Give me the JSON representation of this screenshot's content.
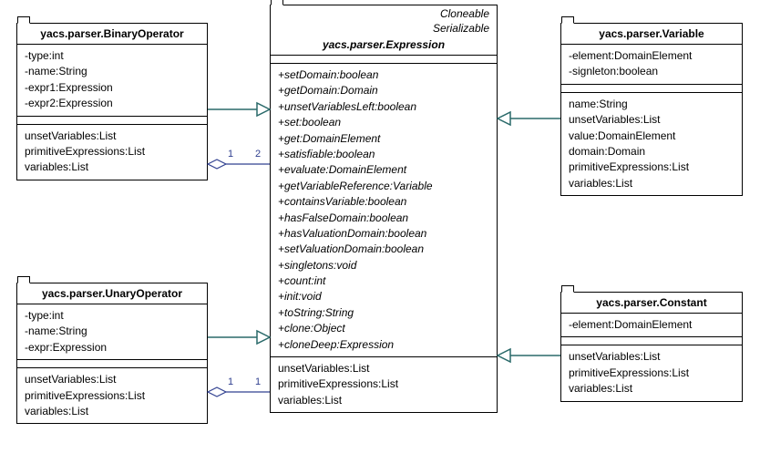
{
  "classes": {
    "binaryOperator": {
      "title": "yacs.parser.BinaryOperator",
      "attrs": [
        "-type:int",
        "-name:String",
        "-expr1:Expression",
        "-expr2:Expression"
      ],
      "members": [
        "unsetVariables:List",
        "primitiveExpressions:List",
        "variables:List"
      ]
    },
    "unaryOperator": {
      "title": "yacs.parser.UnaryOperator",
      "attrs": [
        "-type:int",
        "-name:String",
        "-expr:Expression"
      ],
      "members": [
        "unsetVariables:List",
        "primitiveExpressions:List",
        "variables:List"
      ]
    },
    "expression": {
      "stereotypes": [
        "Cloneable",
        "Serializable"
      ],
      "title": "yacs.parser.Expression",
      "ops": [
        "+setDomain:boolean",
        "+getDomain:Domain",
        "+unsetVariablesLeft:boolean",
        "+set:boolean",
        "+get:DomainElement",
        "+satisfiable:boolean",
        "+evaluate:DomainElement",
        "+getVariableReference:Variable",
        "+containsVariable:boolean",
        "+hasFalseDomain:boolean",
        "+hasValuationDomain:boolean",
        "+setValuationDomain:boolean",
        "+singletons:void",
        "+count:int",
        "+init:void",
        "+toString:String",
        "+clone:Object",
        "+cloneDeep:Expression"
      ],
      "members": [
        "unsetVariables:List",
        "primitiveExpressions:List",
        "variables:List"
      ]
    },
    "variable": {
      "title": "yacs.parser.Variable",
      "attrs": [
        "-element:DomainElement",
        "-signleton:boolean"
      ],
      "members": [
        "name:String",
        "unsetVariables:List",
        "value:DomainElement",
        "domain:Domain",
        "primitiveExpressions:List",
        "variables:List"
      ]
    },
    "constant": {
      "title": "yacs.parser.Constant",
      "attrs": [
        "-element:DomainElement"
      ],
      "members": [
        "unsetVariables:List",
        "primitiveExpressions:List",
        "variables:List"
      ]
    }
  },
  "multiplicities": {
    "binLeft": "1",
    "binRight": "2",
    "unLeft": "1",
    "unRight": "1"
  },
  "chart_data": {
    "type": "uml-class-diagram",
    "classes": [
      {
        "name": "yacs.parser.BinaryOperator",
        "attributes": [
          "-type:int",
          "-name:String",
          "-expr1:Expression",
          "-expr2:Expression"
        ],
        "members": [
          "unsetVariables:List",
          "primitiveExpressions:List",
          "variables:List"
        ]
      },
      {
        "name": "yacs.parser.UnaryOperator",
        "attributes": [
          "-type:int",
          "-name:String",
          "-expr:Expression"
        ],
        "members": [
          "unsetVariables:List",
          "primitiveExpressions:List",
          "variables:List"
        ]
      },
      {
        "name": "yacs.parser.Expression",
        "stereotypes": [
          "Cloneable",
          "Serializable"
        ],
        "abstract": true,
        "operations": [
          "+setDomain:boolean",
          "+getDomain:Domain",
          "+unsetVariablesLeft:boolean",
          "+set:boolean",
          "+get:DomainElement",
          "+satisfiable:boolean",
          "+evaluate:DomainElement",
          "+getVariableReference:Variable",
          "+containsVariable:boolean",
          "+hasFalseDomain:boolean",
          "+hasValuationDomain:boolean",
          "+setValuationDomain:boolean",
          "+singletons:void",
          "+count:int",
          "+init:void",
          "+toString:String",
          "+clone:Object",
          "+cloneDeep:Expression"
        ],
        "members": [
          "unsetVariables:List",
          "primitiveExpressions:List",
          "variables:List"
        ]
      },
      {
        "name": "yacs.parser.Variable",
        "attributes": [
          "-element:DomainElement",
          "-signleton:boolean"
        ],
        "members": [
          "name:String",
          "unsetVariables:List",
          "value:DomainElement",
          "domain:Domain",
          "primitiveExpressions:List",
          "variables:List"
        ]
      },
      {
        "name": "yacs.parser.Constant",
        "attributes": [
          "-element:DomainElement"
        ],
        "members": [
          "unsetVariables:List",
          "primitiveExpressions:List",
          "variables:List"
        ]
      }
    ],
    "relationships": [
      {
        "from": "yacs.parser.BinaryOperator",
        "to": "yacs.parser.Expression",
        "type": "generalization"
      },
      {
        "from": "yacs.parser.UnaryOperator",
        "to": "yacs.parser.Expression",
        "type": "generalization"
      },
      {
        "from": "yacs.parser.Variable",
        "to": "yacs.parser.Expression",
        "type": "generalization"
      },
      {
        "from": "yacs.parser.Constant",
        "to": "yacs.parser.Expression",
        "type": "generalization"
      },
      {
        "from": "yacs.parser.BinaryOperator",
        "to": "yacs.parser.Expression",
        "type": "aggregation",
        "multiplicity": {
          "from": "1",
          "to": "2"
        }
      },
      {
        "from": "yacs.parser.UnaryOperator",
        "to": "yacs.parser.Expression",
        "type": "aggregation",
        "multiplicity": {
          "from": "1",
          "to": "1"
        }
      }
    ]
  }
}
